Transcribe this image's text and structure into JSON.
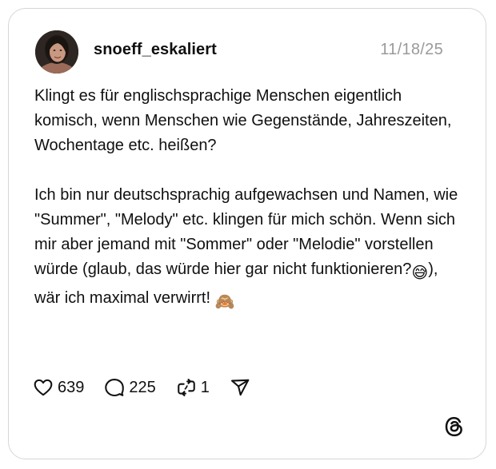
{
  "post": {
    "username": "snoeff_eskaliert",
    "date": "11/18/25",
    "paragraph1": "Klingt es für englischsprachige Menschen eigentlich komisch, wenn Menschen wie Gegenstände, Jahreszeiten, Wochentage etc. heißen?",
    "paragraph2_main": "Ich bin nur deutschsprachig aufgewachsen und Namen, wie \"Summer\", \"Melody\" etc. klingen für mich schön. Wenn sich mir aber jemand mit \"Sommer\" oder \"Melodie\" vorstellen würde (glaub, das würde hier gar nicht funktionieren?",
    "paragraph2_mid": "), wär ich maximal verwirrt! ",
    "emoji1": "😅",
    "emoji2": "🙈"
  },
  "actions": {
    "likes": "639",
    "comments": "225",
    "reposts": "1"
  },
  "icons": {
    "like": "heart-icon",
    "comment": "comment-bubble-icon",
    "repost": "repost-icon",
    "share": "send-icon",
    "brand": "threads-logo-icon"
  }
}
